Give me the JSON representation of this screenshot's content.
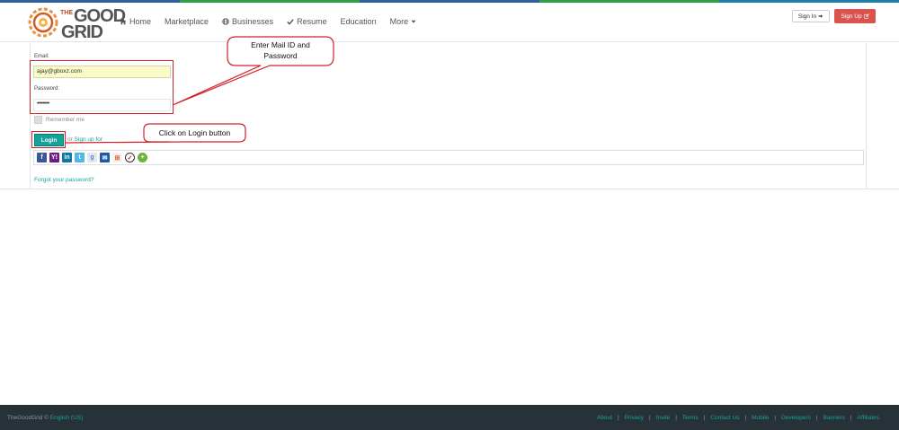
{
  "colors": {
    "stripe": [
      "#2f5d9e",
      "#2f9e44",
      "#2f5d9e",
      "#2f9e44",
      "#1f7fa8"
    ],
    "accent": "#12a39a",
    "signup_bg": "#d9534f",
    "annotation_red": "#d2232a",
    "footer_bg": "#273238"
  },
  "brand": {
    "the": "THE",
    "good": "GOOD",
    "grid": "GRID",
    "logo_icon": "gear-logo-icon"
  },
  "nav": {
    "home": "Home",
    "marketplace": "Marketplace",
    "businesses": "Businesses",
    "resume": "Resume",
    "education": "Education",
    "more": "More"
  },
  "header": {
    "signin_label": "Sign In",
    "signup_label": "Sign Up"
  },
  "form": {
    "email_label": "Email:",
    "email_value": "ajay@gboxz.com",
    "password_label": "Password:",
    "password_value": "•••••••",
    "remember_label": "Remember me",
    "login_label": "Login",
    "or_label": "or",
    "signup_link": "Sign up for",
    "forgot_link": "Forgot your password?"
  },
  "social": {
    "icons": [
      "facebook-icon",
      "yahoo-icon",
      "linkedin-icon",
      "twitter-icon",
      "google-icon",
      "outlook-icon",
      "windows-live-icon",
      "verisign-icon",
      "add-more-icon"
    ],
    "glyphs": [
      "f",
      "Y!",
      "in",
      "t",
      "g",
      "✉",
      "⊞",
      "✓",
      "+"
    ]
  },
  "annotations": {
    "callout_1": "Enter Mail ID and Password",
    "callout_1_line1": "Enter Mail ID and",
    "callout_1_line2": "Password",
    "callout_2": "Click on Login button"
  },
  "footer": {
    "copyright": "TheGoodGrid ©",
    "language": "English (US)",
    "links": [
      "About",
      "Privacy",
      "Invite",
      "Terms",
      "Contact Us",
      "Mobile",
      "Developers",
      "Banners",
      "Affiliates"
    ]
  }
}
